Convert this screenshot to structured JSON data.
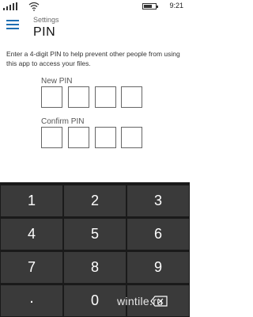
{
  "status_bar": {
    "time": "9:21",
    "battery_level": 0.7
  },
  "header": {
    "breadcrumb": "Settings",
    "title": "PIN"
  },
  "main": {
    "description": "Enter a 4-digit PIN to help prevent other people from using this app to access your files.",
    "new_pin_label": "New PIN",
    "confirm_pin_label": "Confirm PIN",
    "new_pin_digits": [
      "",
      "",
      "",
      ""
    ],
    "confirm_pin_digits": [
      "",
      "",
      "",
      ""
    ]
  },
  "keypad": {
    "keys": [
      "1",
      "2",
      "3",
      "4",
      "5",
      "6",
      "7",
      "8",
      "9",
      ".",
      "0"
    ]
  },
  "watermark": "wintile.ru",
  "colors": {
    "accent": "#1f6fb2",
    "keypad_bg": "#1a1a1a",
    "key_bg": "#3a3a3a"
  }
}
